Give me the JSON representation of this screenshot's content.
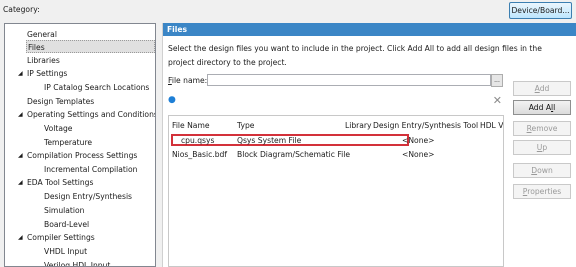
{
  "header": {
    "category_label": "Category:",
    "device_board_label": "Device/Board..."
  },
  "tree": {
    "items": [
      {
        "label": "General",
        "arrow": ""
      },
      {
        "label": "Files",
        "arrow": "",
        "selected": true
      },
      {
        "label": "Libraries",
        "arrow": ""
      },
      {
        "label": "IP Settings",
        "arrow": "◢"
      },
      {
        "label": "IP Catalog Search Locations",
        "arrow": ""
      },
      {
        "label": "Design Templates",
        "arrow": ""
      },
      {
        "label": "Operating Settings and Conditions",
        "arrow": "◢"
      },
      {
        "label": "Voltage",
        "arrow": ""
      },
      {
        "label": "Temperature",
        "arrow": ""
      },
      {
        "label": "Compilation Process Settings",
        "arrow": "◢"
      },
      {
        "label": "Incremental Compilation",
        "arrow": ""
      },
      {
        "label": "EDA Tool Settings",
        "arrow": "◢"
      },
      {
        "label": "Design Entry/Synthesis",
        "arrow": ""
      },
      {
        "label": "Simulation",
        "arrow": ""
      },
      {
        "label": "Board-Level",
        "arrow": ""
      },
      {
        "label": "Compiler Settings",
        "arrow": "◢"
      },
      {
        "label": "VHDL Input",
        "arrow": ""
      },
      {
        "label": "Verilog HDL Input",
        "arrow": ""
      }
    ]
  },
  "files_panel": {
    "title": "Files",
    "instructions": "Select the design files you want to include in the project. Click Add All to add all design files in the project directory to the project.",
    "file_name_label_first": "F",
    "file_name_label_rest": "ile name:",
    "browse_label": "...",
    "search_icon": "search-icon",
    "clear_icon": "clear-icon",
    "columns": [
      "File Name",
      "Type",
      "Library",
      "Design Entry/Synthesis Tool",
      "HDL Ve"
    ],
    "rows": [
      {
        "file": "cpu.qsys",
        "type": "Qsys System File",
        "library": "",
        "tool": "<None>"
      },
      {
        "file": "Nios_Basic.bdf",
        "type": "Block Diagram/Schematic File",
        "library": "",
        "tool": "<None>"
      }
    ],
    "buttons": {
      "add": {
        "first": "A",
        "rest": "dd"
      },
      "add_all": {
        "pre": "Add A",
        "key": "l",
        "post": "l"
      },
      "remove": {
        "first": "R",
        "rest": "emove"
      },
      "up": {
        "first": "U",
        "rest": "p"
      },
      "down": {
        "first": "D",
        "rest": "own"
      },
      "properties": {
        "first": "P",
        "rest": "roperties"
      }
    }
  }
}
